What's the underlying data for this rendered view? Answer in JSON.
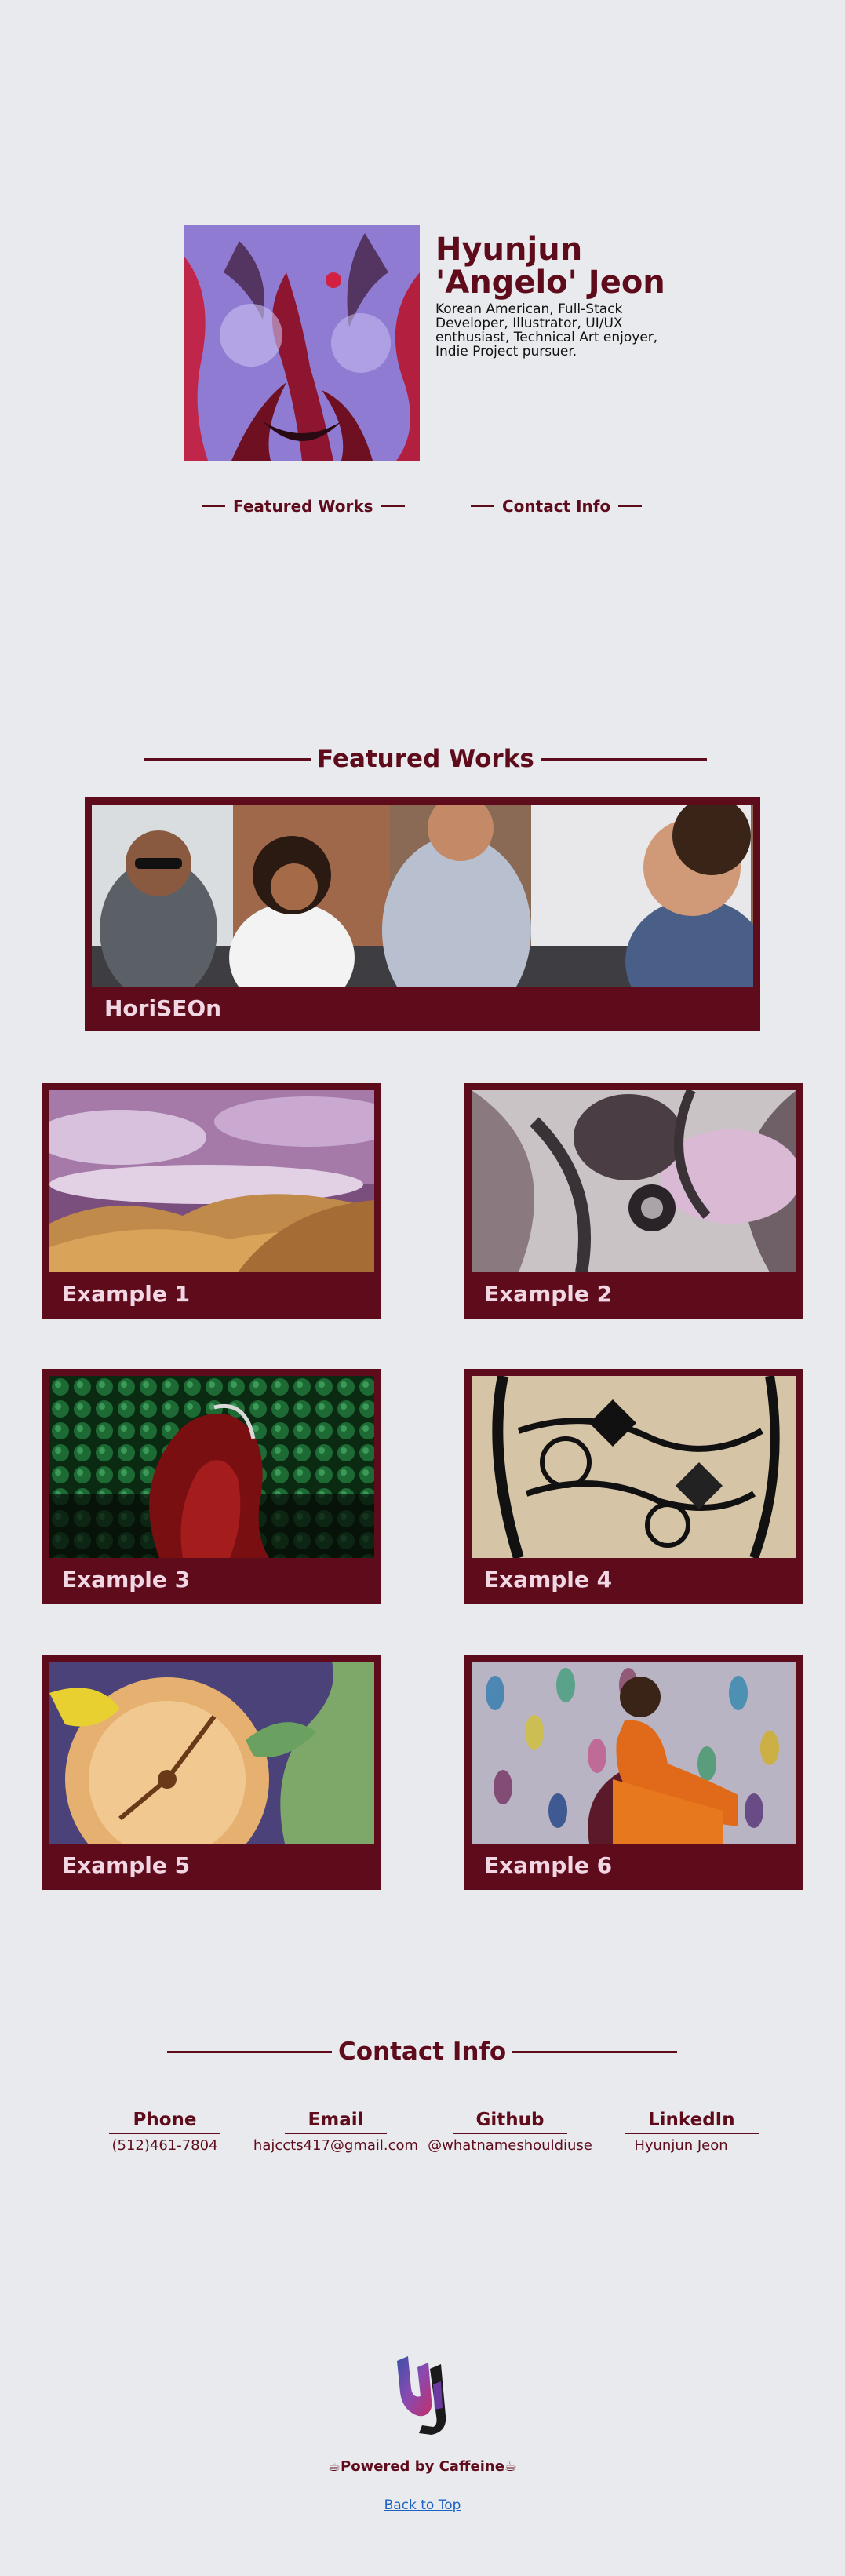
{
  "hero": {
    "name": "Hyunjun 'Angelo' Jeon",
    "bio": "Korean American, Full-Stack Developer, Illustrator, UI/UX enthusiast, Technical Art enjoyer, Indie Project pursuer.",
    "nav": [
      {
        "label": "Featured Works"
      },
      {
        "label": "Contact Info"
      }
    ]
  },
  "featured": {
    "heading": "Featured Works",
    "main": {
      "label": "HoriSEOn"
    },
    "items": [
      {
        "label": "Example 1"
      },
      {
        "label": "Example 2"
      },
      {
        "label": "Example 3"
      },
      {
        "label": "Example 4"
      },
      {
        "label": "Example 5"
      },
      {
        "label": "Example 6"
      }
    ]
  },
  "contact": {
    "heading": "Contact Info",
    "items": [
      {
        "label": "Phone",
        "value": "(512)461-7804"
      },
      {
        "label": "Email",
        "value": "hajccts417@gmail.com"
      },
      {
        "label": "Github",
        "value": "@whatnameshouldiuse"
      },
      {
        "label": "LinkedIn",
        "value": "Hyunjun Jeon"
      }
    ]
  },
  "footer": {
    "powered": "☕Powered by Caffeine☕",
    "back_to_top": "Back to Top"
  },
  "colors": {
    "background": "#e8eaed",
    "accent": "#5e0b1c",
    "caption": "#f1d7e4",
    "link": "#1a62c4"
  }
}
